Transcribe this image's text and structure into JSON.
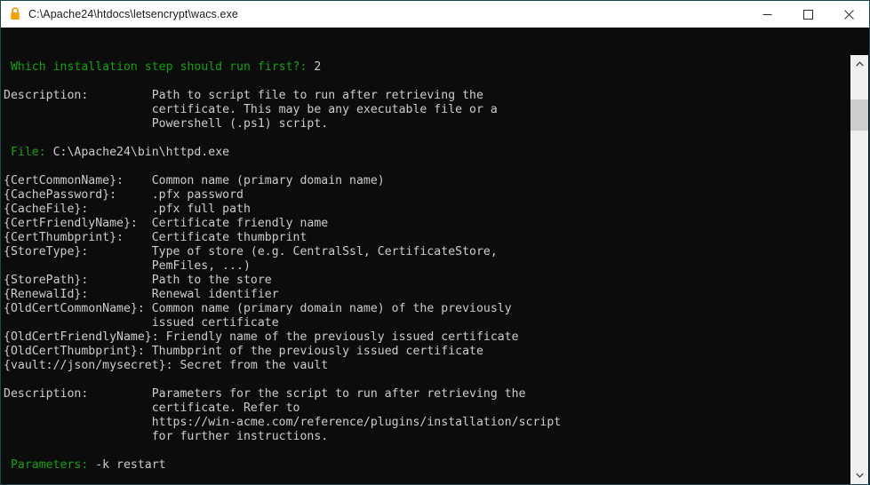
{
  "window": {
    "title": "C:\\Apache24\\htdocs\\letsencrypt\\wacs.exe",
    "lock_icon": "lock-icon",
    "minimize_label": "Minimize",
    "maximize_label": "Maximize",
    "close_label": "Close"
  },
  "colors": {
    "console_background": "#0c0c0c",
    "console_foreground": "#cccccc",
    "console_green": "#13a10e",
    "window_border": "#1b4551",
    "titlebar_background": "#ffffff",
    "lock_icon_color": "#f0a30a",
    "scrollbar_track": "#f0f0f0",
    "scrollbar_thumb": "#cdcdcd"
  },
  "scrollbar": {
    "up_arrow": "chevron-up-icon",
    "down_arrow": "chevron-down-icon",
    "thumb": "scrollbar-thumb"
  },
  "console": {
    "prompt_question": " Which installation step should run first?: ",
    "prompt_answer": "2",
    "description_label_1": "Description:",
    "description_lines_1": [
      "Path to script file to run after retrieving the",
      "certificate. This may be any executable file or a",
      "Powershell (.ps1) script."
    ],
    "file_label": " File: ",
    "file_value": "C:\\Apache24\\bin\\httpd.exe",
    "variables": [
      {
        "token": "{CertCommonName}:",
        "desc": "Common name (primary domain name)"
      },
      {
        "token": "{CachePassword}:",
        "desc": ".pfx password"
      },
      {
        "token": "{CacheFile}:",
        "desc": ".pfx full path"
      },
      {
        "token": "{CertFriendlyName}:",
        "desc": "Certificate friendly name"
      },
      {
        "token": "{CertThumbprint}:",
        "desc": "Certificate thumbprint"
      },
      {
        "token": "{StoreType}:",
        "desc": "Type of store (e.g. CentralSsl, CertificateStore,"
      },
      {
        "token": "",
        "desc": "PemFiles, ...)"
      },
      {
        "token": "{StorePath}:",
        "desc": "Path to the store"
      },
      {
        "token": "{RenewalId}:",
        "desc": "Renewal identifier"
      },
      {
        "token": "{OldCertCommonName}:",
        "desc": "Common name (primary domain name) of the previously"
      },
      {
        "token": "",
        "desc": "issued certificate"
      },
      {
        "token": "{OldCertFriendlyName}:",
        "desc": "Friendly name of the previously issued certificate"
      },
      {
        "token": "{OldCertThumbprint}:",
        "desc": "Thumbprint of the previously issued certificate"
      },
      {
        "token": "{vault://json/mysecret}:",
        "desc": "Secret from the vault"
      }
    ],
    "description_label_2": "Description:",
    "description_lines_2": [
      "Parameters for the script to run after retrieving the",
      "certificate. Refer to",
      "https://win-acme.com/reference/plugins/installation/script",
      "for further instructions."
    ],
    "parameters_label": " Parameters: ",
    "parameters_value": "-k restart"
  }
}
